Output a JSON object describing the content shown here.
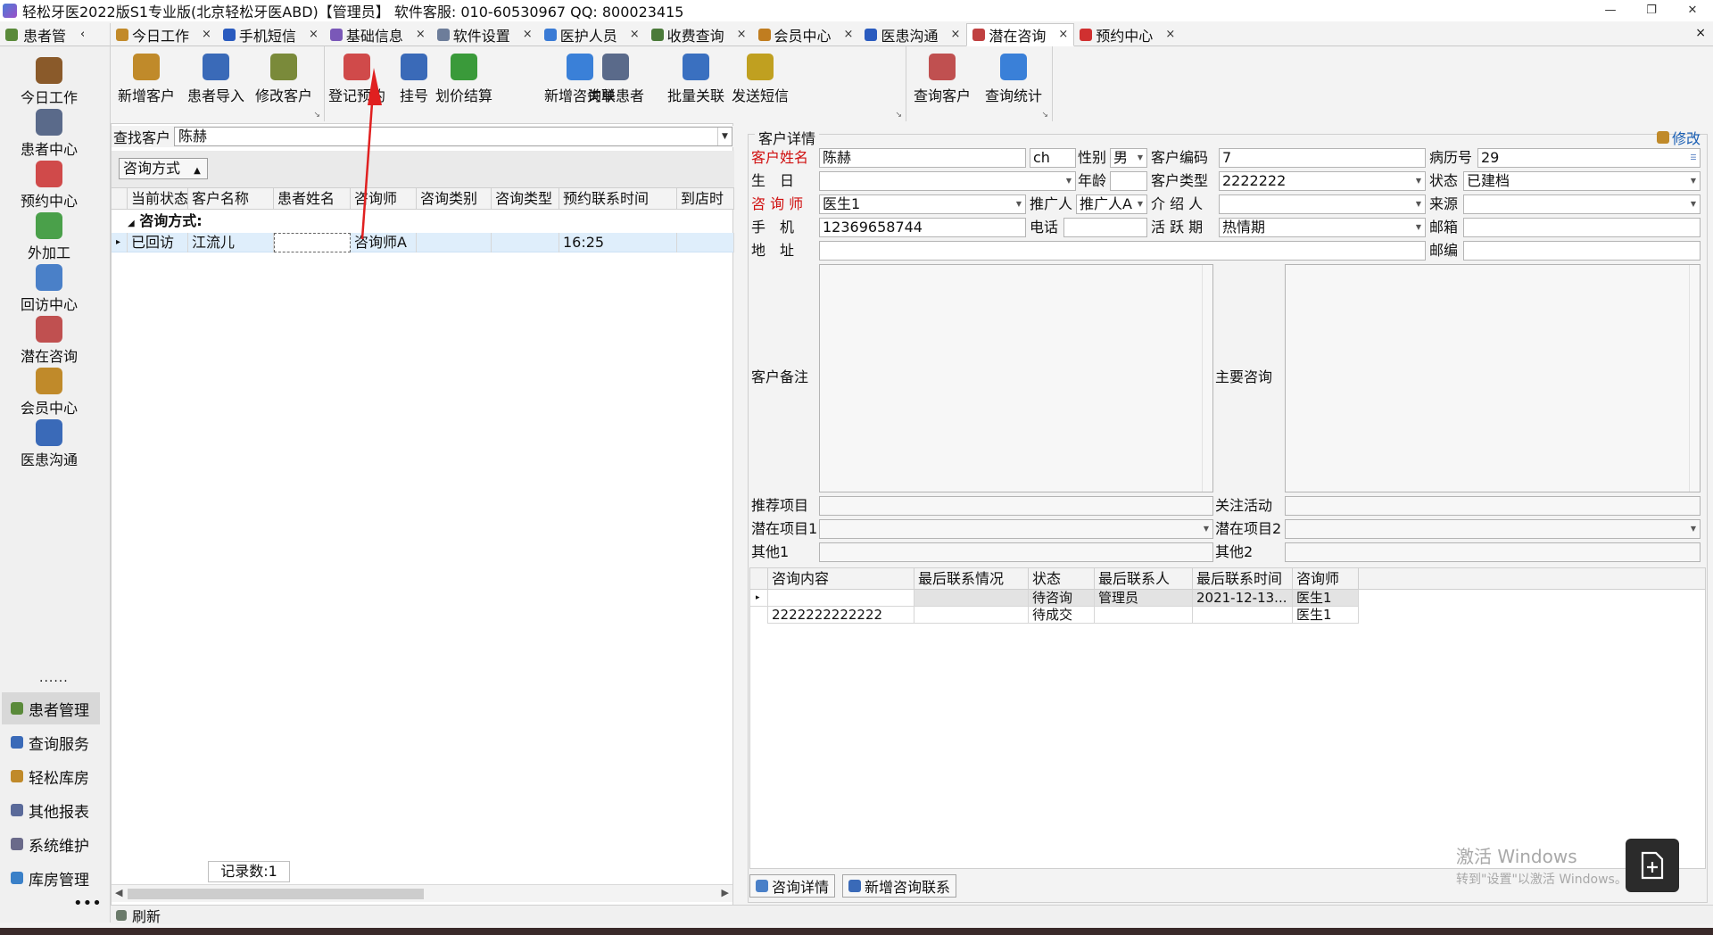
{
  "window": {
    "title": "轻松牙医2022版S1专业版(北京轻松牙医ABD)【管理员】    软件客服: 010-60530967  QQ: 800023415",
    "minimize": "—",
    "restore": "❐",
    "close": "✕"
  },
  "left_header": "患者管",
  "tabs": [
    {
      "label": "今日工作",
      "color": "#c28a2a"
    },
    {
      "label": "手机短信",
      "color": "#2a5bbf"
    },
    {
      "label": "基础信息",
      "color": "#7a58b8"
    },
    {
      "label": "软件设置",
      "color": "#6d7d9a"
    },
    {
      "label": "医护人员",
      "color": "#3a7bd5"
    },
    {
      "label": "收费查询",
      "color": "#4b7a3a"
    },
    {
      "label": "会员中心",
      "color": "#c07d20"
    },
    {
      "label": "医患沟通",
      "color": "#2a5bbf"
    },
    {
      "label": "潜在咨询",
      "color": "#c04040"
    },
    {
      "label": "预约中心",
      "color": "#d03030"
    }
  ],
  "tab_close": "×",
  "sidebar": {
    "nav": [
      {
        "label": "今日工作",
        "color": "#8a5a2a"
      },
      {
        "label": "患者中心",
        "color": "#5a6a8a"
      },
      {
        "label": "预约中心",
        "color": "#d04a4a"
      },
      {
        "label": "外加工",
        "color": "#4aa04a"
      },
      {
        "label": "回访中心",
        "color": "#4a80c8"
      },
      {
        "label": "潜在咨询",
        "color": "#c05050"
      },
      {
        "label": "会员中心",
        "color": "#c08a2a"
      },
      {
        "label": "医患沟通",
        "color": "#3a6ab8"
      }
    ],
    "dots": "......",
    "modules": [
      {
        "label": "患者管理",
        "color": "#5a8a3a"
      },
      {
        "label": "查询服务",
        "color": "#3a6ab8"
      },
      {
        "label": "轻松库房",
        "color": "#c08a2a"
      },
      {
        "label": "其他报表",
        "color": "#5a6a9a"
      },
      {
        "label": "系统维护",
        "color": "#6a6a8a"
      },
      {
        "label": "库房管理",
        "color": "#3a80c8"
      }
    ],
    "more": "•••"
  },
  "ribbon": {
    "group1": [
      {
        "label": "新增客户",
        "color": "#c08a2a"
      },
      {
        "label": "患者导入",
        "color": "#3a6ab8"
      },
      {
        "label": "修改客户",
        "color": "#7a8a3a"
      }
    ],
    "group2": [
      {
        "label": "登记预约",
        "color": "#d04a4a"
      },
      {
        "label": "挂号",
        "color": "#3a6ab8"
      },
      {
        "label": "划价结算",
        "color": "#3a9a3a"
      },
      {
        "label": "新增咨询单",
        "color": "#3a80d8"
      },
      {
        "label": "关联患者",
        "color": "#5a6a8a"
      },
      {
        "label": "批量关联",
        "color": "#3a70c0"
      },
      {
        "label": "发送短信",
        "color": "#c0a020"
      }
    ],
    "group3": [
      {
        "label": "查询客户",
        "color": "#c05050"
      },
      {
        "label": "查询统计",
        "color": "#3a80d8"
      }
    ],
    "launcher": "↘"
  },
  "search": {
    "label": "查找客户",
    "value": "陈赫"
  },
  "groupby": {
    "label": "咨询方式",
    "arrow": "▲"
  },
  "grid": {
    "columns": [
      "当前状态",
      "客户名称",
      "患者姓名",
      "咨询师",
      "咨询类别",
      "咨询类型",
      "预约联系时间",
      "到店时"
    ],
    "group_label": "咨询方式:",
    "rows": [
      {
        "status": "已回访",
        "customer": "江流儿",
        "patient": "",
        "consultant": "咨询师A",
        "category": "",
        "type": "",
        "contact_time": "16:25",
        "arrive": ""
      }
    ],
    "record_count": "记录数:1"
  },
  "detail": {
    "caption": "客户详情",
    "edit_label": "修改",
    "labels": {
      "name": "客户姓名",
      "gender": "性别",
      "code": "客户编码",
      "record_no": "病历号",
      "birthday": "生　日",
      "age": "年龄",
      "cust_type": "客户类型",
      "state": "状态",
      "consultant": "咨 询 师",
      "promoter": "推广人",
      "referrer": "介 绍 人",
      "source": "来源",
      "mobile": "手　机",
      "phone": "电话",
      "active_period": "活 跃 期",
      "email": "邮箱",
      "address": "地　址",
      "postcode": "邮编",
      "remark": "客户备注",
      "main_consult": "主要咨询",
      "rec_project": "推荐项目",
      "focus_activity": "关注活动",
      "potential1": "潜在项目1",
      "potential2": "潜在项目2",
      "other1": "其他1",
      "other2": "其他2"
    },
    "values": {
      "name": "陈赫",
      "pinyin": "ch",
      "gender": "男",
      "code": "7",
      "record_no": "29",
      "birthday": "",
      "age": "",
      "cust_type": "2222222",
      "state": "已建档",
      "consultant": "医生1",
      "promoter": "推广人A",
      "referrer": "",
      "source": "",
      "mobile": "12369658744",
      "phone": "",
      "active_period": "热情期",
      "email": "",
      "address": "",
      "postcode": ""
    }
  },
  "consult_grid": {
    "columns": [
      "咨询内容",
      "最后联系情况",
      "状态",
      "最后联系人",
      "最后联系时间",
      "咨询师"
    ],
    "rows": [
      {
        "content": "",
        "last_situation": "",
        "status": "待咨询",
        "last_contact": "管理员",
        "last_time": "2021-12-13...",
        "consultant": "医生1"
      },
      {
        "content": "2222222222222",
        "last_situation": "",
        "status": "待成交",
        "last_contact": "",
        "last_time": "",
        "consultant": "医生1"
      }
    ]
  },
  "bottom_buttons": [
    {
      "label": "咨询详情"
    },
    {
      "label": "新增咨询联系"
    }
  ],
  "statusbar": {
    "refresh": "刷新"
  },
  "watermark": {
    "line1": "激活 Windows",
    "line2": "转到\"设置\"以激活 Windows。"
  }
}
